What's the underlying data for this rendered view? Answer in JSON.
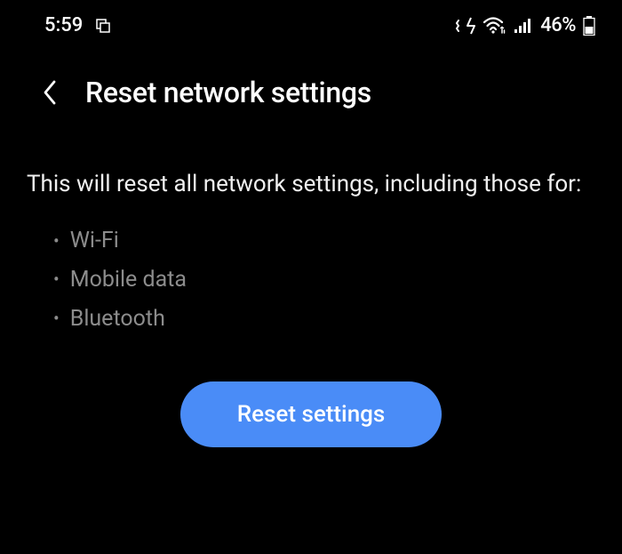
{
  "statusBar": {
    "time": "5:59",
    "batteryPercent": "46%"
  },
  "header": {
    "title": "Reset network settings"
  },
  "content": {
    "description": "This will reset all network settings, including those for:",
    "items": [
      "Wi-Fi",
      "Mobile data",
      "Bluetooth"
    ]
  },
  "button": {
    "label": "Reset settings"
  }
}
